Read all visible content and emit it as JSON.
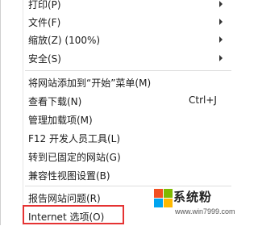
{
  "menu": {
    "items": [
      {
        "label": "打印(P)",
        "shortcut": "",
        "submenu": true
      },
      {
        "label": "文件(F)",
        "shortcut": "",
        "submenu": true
      },
      {
        "label": "缩放(Z) (100%)",
        "shortcut": "",
        "submenu": true
      },
      {
        "label": "安全(S)",
        "shortcut": "",
        "submenu": true
      },
      {
        "label": "将网站添加到“开始”菜单(M)",
        "shortcut": "",
        "submenu": false
      },
      {
        "label": "查看下载(N)",
        "shortcut": "Ctrl+J",
        "submenu": false
      },
      {
        "label": "管理加载项(M)",
        "shortcut": "",
        "submenu": false
      },
      {
        "label": "F12 开发人员工具(L)",
        "shortcut": "",
        "submenu": false
      },
      {
        "label": "转到已固定的网站(G)",
        "shortcut": "",
        "submenu": false
      },
      {
        "label": "兼容性视图设置(B)",
        "shortcut": "",
        "submenu": false
      },
      {
        "label": "报告网站问题(R)",
        "shortcut": "",
        "submenu": false
      },
      {
        "label": "Internet 选项(O)",
        "shortcut": "",
        "submenu": false
      }
    ]
  },
  "watermark": {
    "brand": "系统粉",
    "url": "www.win7999.com",
    "colors": {
      "red": "#f25022",
      "green": "#7fba00",
      "blue": "#00a4ef",
      "yellow": "#ffb900"
    }
  },
  "colors": {
    "highlight_border": "#e53333"
  }
}
